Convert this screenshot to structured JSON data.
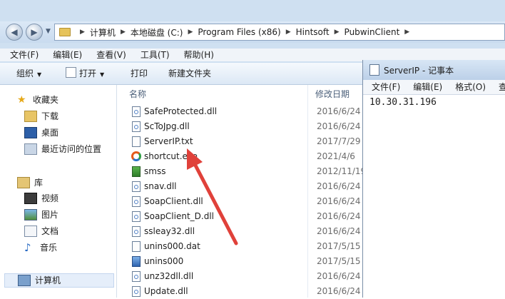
{
  "address": {
    "crumbs": [
      "计算机",
      "本地磁盘 (C:)",
      "Program Files (x86)",
      "Hintsoft",
      "PubwinClient"
    ]
  },
  "menu": [
    "文件(F)",
    "编辑(E)",
    "查看(V)",
    "工具(T)",
    "帮助(H)"
  ],
  "toolbar": {
    "organize": "组织",
    "open": "打开",
    "print": "打印",
    "new_folder": "新建文件夹"
  },
  "sidebar": {
    "favorites": "收藏夹",
    "downloads": "下载",
    "desktop": "桌面",
    "recent": "最近访问的位置",
    "libraries": "库",
    "videos": "视频",
    "pictures": "图片",
    "documents": "文档",
    "music": "音乐",
    "computer": "计算机"
  },
  "columns": {
    "name": "名称",
    "date": "修改日期"
  },
  "files": [
    {
      "name": "SafeProtected.dll",
      "date": "2016/6/24",
      "icon": "dll-icon"
    },
    {
      "name": "ScToJpg.dll",
      "date": "2016/6/24",
      "icon": "dll-icon"
    },
    {
      "name": "ServerIP.txt",
      "date": "2017/7/29",
      "icon": "text-file-icon"
    },
    {
      "name": "shortcut.exe",
      "date": "2021/4/6",
      "icon": "shortcut-icon"
    },
    {
      "name": "smss",
      "date": "2012/11/19",
      "icon": "exe-icon"
    },
    {
      "name": "snav.dll",
      "date": "2016/6/24",
      "icon": "dll-icon"
    },
    {
      "name": "SoapClient.dll",
      "date": "2016/6/24",
      "icon": "dll-icon"
    },
    {
      "name": "SoapClient_D.dll",
      "date": "2016/6/24",
      "icon": "dll-icon"
    },
    {
      "name": "ssleay32.dll",
      "date": "2016/6/24",
      "icon": "dll-icon"
    },
    {
      "name": "unins000.dat",
      "date": "2017/5/15",
      "icon": "text-file-icon"
    },
    {
      "name": "unins000",
      "date": "2017/5/15",
      "icon": "exe-icon"
    },
    {
      "name": "unz32dll.dll",
      "date": "2016/6/24",
      "icon": "dll-icon"
    },
    {
      "name": "Update.dll",
      "date": "2016/6/24",
      "icon": "dll-icon"
    }
  ],
  "notepad": {
    "title": "ServerIP - 记事本",
    "menu": [
      "文件(F)",
      "编辑(E)",
      "格式(O)",
      "查看("
    ],
    "content": "10.30.31.196"
  },
  "colors": {
    "arrow": "#e0413a",
    "accent": "#cfe0f1"
  }
}
